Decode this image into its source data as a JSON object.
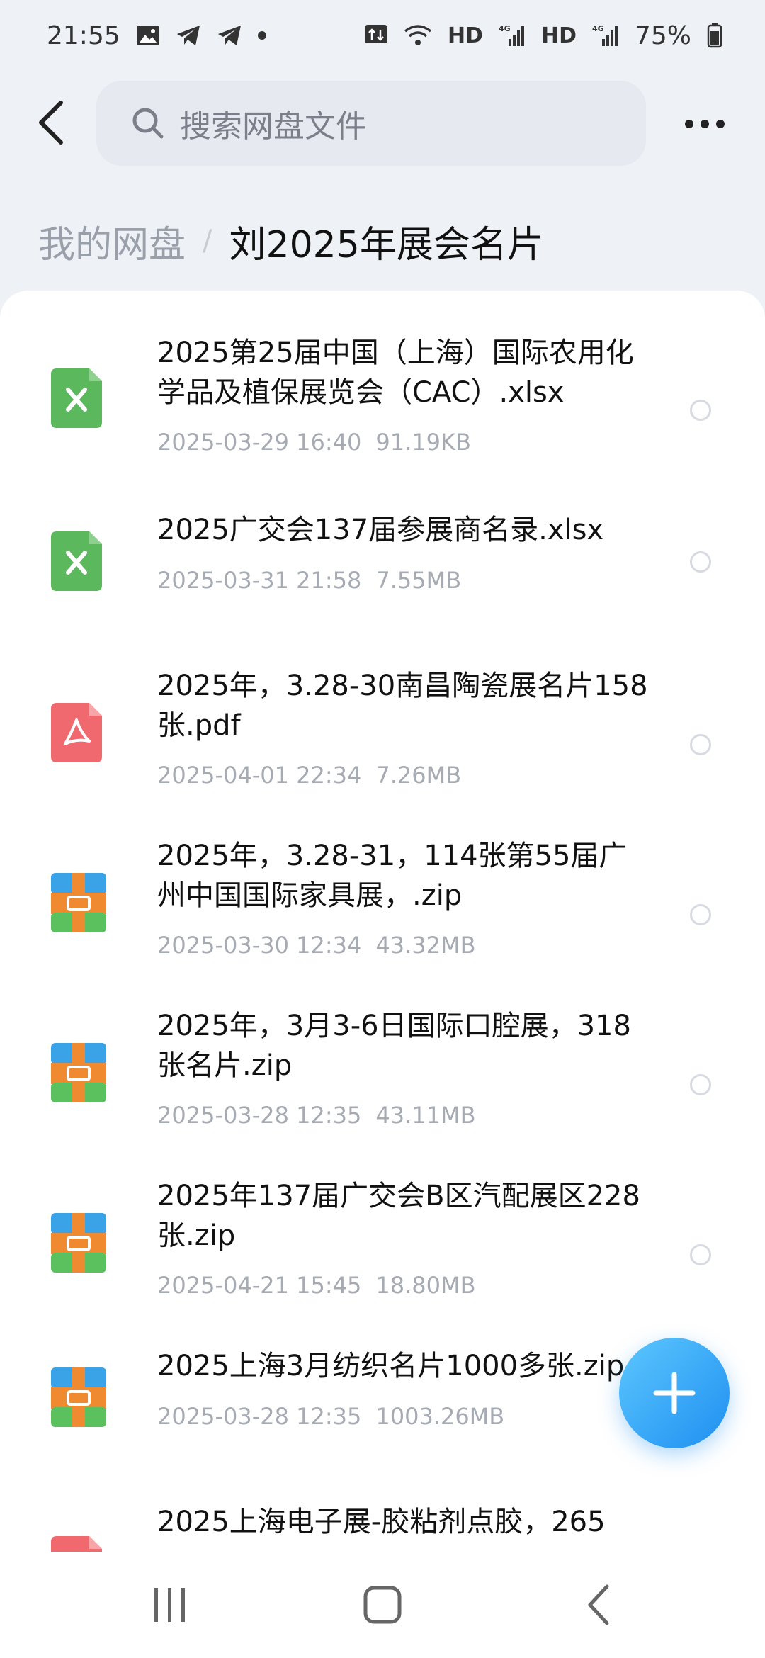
{
  "status_bar": {
    "time": "21:55",
    "network_hd1": "HD",
    "network_4g1": "4G",
    "network_hd2": "HD",
    "network_4g2": "4G",
    "battery": "75%"
  },
  "header": {
    "search_placeholder": "搜索网盘文件"
  },
  "breadcrumb": {
    "root": "我的网盘",
    "separator": "/",
    "current": "刘2025年展会名片"
  },
  "files": [
    {
      "name": "2025第25届中国（上海）国际农用化学品及植保展览会（CAC）.xlsx",
      "date": "2025-03-29 16:40",
      "size": "91.19KB",
      "icon": "excel-icon"
    },
    {
      "name": "2025广交会137届参展商名录.xlsx",
      "date": "2025-03-31 21:58",
      "size": "7.55MB",
      "icon": "excel-icon"
    },
    {
      "name": "2025年，3.28-30南昌陶瓷展名片158张.pdf",
      "date": "2025-04-01 22:34",
      "size": "7.26MB",
      "icon": "pdf-icon"
    },
    {
      "name": "2025年，3.28-31，114张第55届广州中国国际家具展，.zip",
      "date": "2025-03-30 12:34",
      "size": "43.32MB",
      "icon": "zip-icon"
    },
    {
      "name": "2025年，3月3-6日国际口腔展，318张名片.zip",
      "date": "2025-03-28 12:35",
      "size": "43.11MB",
      "icon": "zip-icon"
    },
    {
      "name": "2025年137届广交会B区汽配展区228张.zip",
      "date": "2025-04-21 15:45",
      "size": "18.80MB",
      "icon": "zip-icon"
    },
    {
      "name": "2025上海3月纺织名片1000多张.zip",
      "date": "2025-03-28 12:35",
      "size": "1003.26MB",
      "icon": "zip-icon"
    },
    {
      "name": "2025上海电子展-胶粘剂点胶，265",
      "date": "",
      "size": "",
      "icon": "pdf-icon"
    }
  ],
  "colors": {
    "excel": "#5cb85c",
    "pdf": "#f0696f",
    "zip_top": "#3aa3e8",
    "zip_mid": "#f08a30",
    "zip_bottom": "#5bc15f",
    "accent": "#1e8ff0"
  }
}
